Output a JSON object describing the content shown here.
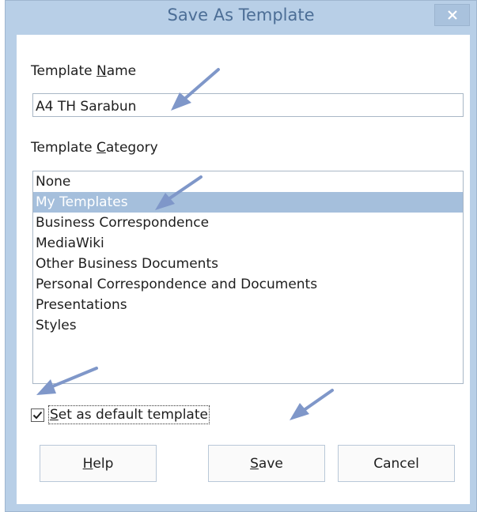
{
  "window": {
    "title": "Save As Template",
    "close_glyph": "×"
  },
  "template_name": {
    "label_pre": "Template ",
    "label_accel": "N",
    "label_post": "ame",
    "value": "A4 TH Sarabun"
  },
  "template_category": {
    "label_pre": "Template ",
    "label_accel": "C",
    "label_post": "ategory",
    "items": [
      "None",
      "My Templates",
      "Business Correspondence",
      "MediaWiki",
      "Other Business Documents",
      "Personal Correspondence and Documents",
      "Presentations",
      "Styles"
    ],
    "selected_index": 1
  },
  "default_template": {
    "checked": true,
    "label_accel": "S",
    "label_post": "et as default template"
  },
  "buttons": {
    "help": {
      "accel": "H",
      "rest": "elp"
    },
    "save": {
      "accel": "S",
      "rest": "ave"
    },
    "cancel": {
      "label": "Cancel"
    }
  },
  "colors": {
    "frame": "#b8cfe7",
    "title_text": "#4c6e96",
    "selection": "#a5bfdc",
    "annotation_arrow": "#7f97c9"
  },
  "icons": [
    "close-icon",
    "checkmark-icon",
    "annotation-arrow-icon"
  ]
}
